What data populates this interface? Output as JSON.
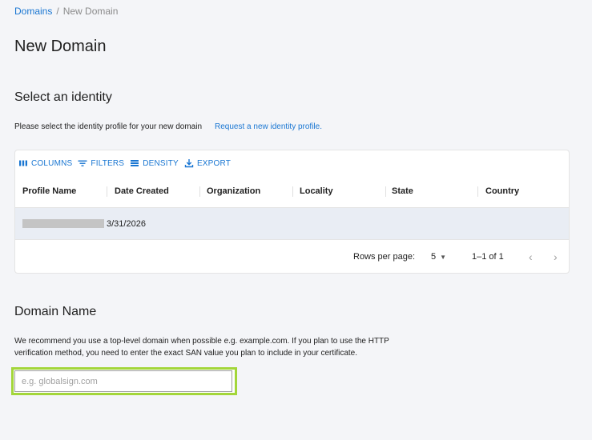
{
  "breadcrumb": {
    "parent": "Domains",
    "separator": "/",
    "current": "New Domain"
  },
  "page_title": "New Domain",
  "identity": {
    "title": "Select an identity",
    "description": "Please select the identity profile for your new domain",
    "request_link": "Request a new identity profile."
  },
  "grid": {
    "toolbar": {
      "columns": "COLUMNS",
      "filters": "FILTERS",
      "density": "DENSITY",
      "export": "EXPORT"
    },
    "columns": [
      "Profile Name",
      "Date Created",
      "Organization",
      "Locality",
      "State",
      "Country"
    ],
    "rows": [
      {
        "profile_name": "",
        "date_created": "3/31/2026"
      }
    ],
    "footer": {
      "rows_per_page_label": "Rows per page:",
      "rows_per_page_value": "5",
      "range": "1–1 of 1",
      "prev_icon": "chevron-left-icon",
      "next_icon": "chevron-right-icon"
    }
  },
  "domain": {
    "title": "Domain Name",
    "description_line1": "We recommend you use a top-level domain when possible e.g. example.com. If you plan to use the HTTP",
    "description_line2": "verification method, you need to enter the exact SAN value you plan to include in your certificate.",
    "input_value": "",
    "input_placeholder": "e.g. globalsign.com"
  },
  "colors": {
    "accent": "#1976d2",
    "focus_highlight": "#a3d63a",
    "background": "#f4f5f8"
  }
}
